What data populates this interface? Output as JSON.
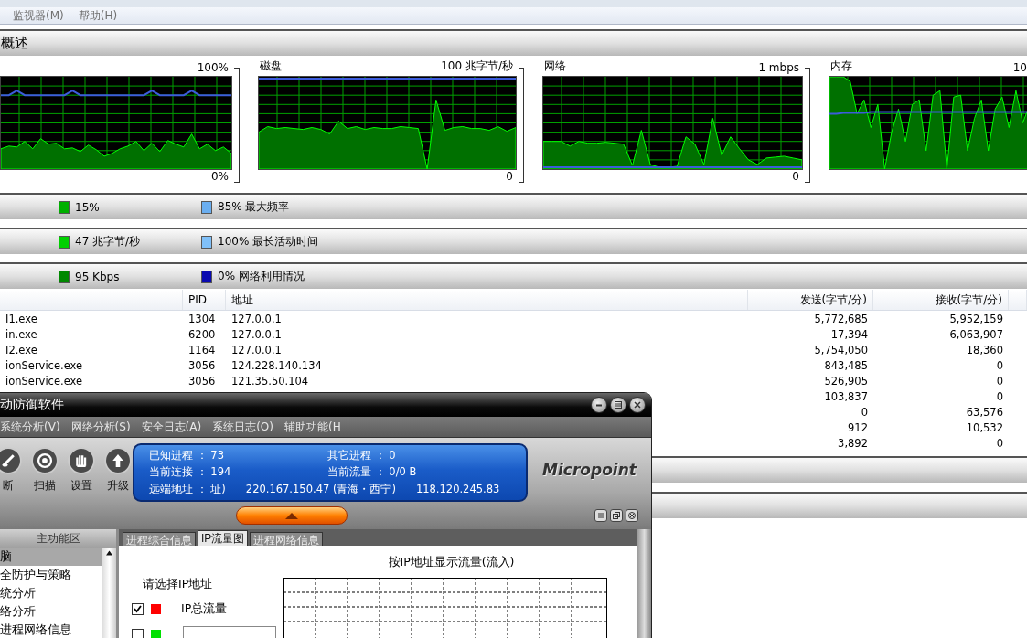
{
  "menu_bar": [
    {
      "label": "监视器(M)",
      "disabled": true
    },
    {
      "label": "帮助(H)",
      "disabled": true
    }
  ],
  "overview": {
    "title": "概述",
    "graphs": [
      {
        "scale_max": "100%",
        "scale_min": "0%"
      },
      {
        "title": "磁盘",
        "scale_max": "100 兆字节/秒",
        "scale_min": "0"
      },
      {
        "title": "网络",
        "scale_max": "1 mbps",
        "scale_min": "0"
      },
      {
        "title": "内存",
        "scale_max": "10"
      }
    ]
  },
  "summary_bars": [
    {
      "primary": {
        "text": "15%",
        "color": "#00b000"
      },
      "secondary": {
        "text": "85% 最大频率",
        "color": "#6aaef0"
      }
    },
    {
      "primary": {
        "text": "47 兆字节/秒",
        "color": "#00d000"
      },
      "secondary": {
        "text": "100% 最长活动时间",
        "color": "#80c0f8"
      }
    },
    {
      "primary": {
        "text": "95 Kbps",
        "color": "#008800"
      },
      "secondary": {
        "text": "0% 网络利用情况",
        "color": "#0a0ab0"
      }
    }
  ],
  "table": {
    "columns": [
      "PID",
      "地址",
      "发送(字节/分)",
      "接收(字节/分)"
    ],
    "rows": [
      {
        "column_1": "I1.exe",
        "pid": "1304",
        "address": "127.0.0.1",
        "sent": "5,772,685",
        "received": "5,952,159"
      },
      {
        "column_1": "in.exe",
        "pid": "6200",
        "address": "127.0.0.1",
        "sent": "17,394",
        "received": "6,063,907"
      },
      {
        "column_1": "I2.exe",
        "pid": "1164",
        "address": "127.0.0.1",
        "sent": "5,754,050",
        "received": "18,360"
      },
      {
        "column_1": "ionService.exe",
        "pid": "3056",
        "address": "124.228.140.134",
        "sent": "843,485",
        "received": "0"
      },
      {
        "column_1": "ionService.exe",
        "pid": "3056",
        "address": "121.35.50.104",
        "sent": "526,905",
        "received": "0"
      },
      {
        "sent": "103,837",
        "received": "0"
      },
      {
        "sent": "0",
        "received": "63,576"
      },
      {
        "sent": "912",
        "received": "10,532"
      },
      {
        "sent": "3,892",
        "received": "0"
      }
    ]
  },
  "overlay_window": {
    "title": "动防御软件",
    "menu": [
      "系统分析(V)",
      "网络分析(S)",
      "安全日志(A)",
      "系统日志(O)",
      "辅助功能(H"
    ],
    "toolbar": [
      {
        "label": "断",
        "kind": "cut"
      },
      {
        "label": "扫描",
        "kind": "scan"
      },
      {
        "label": "设置",
        "kind": "settings"
      },
      {
        "label": "升级",
        "kind": "upgrade"
      }
    ],
    "status": [
      [
        "已知进程 ： 73",
        "其它进程 ： 0"
      ],
      [
        "当前连接 ： 194",
        "当前流量 ： 0/0 B"
      ]
    ],
    "remote": [
      "远端地址 ：  址)",
      "220.167.150.47 (青海・西宁)",
      "118.120.245.83"
    ],
    "logo": "Micropoint",
    "side_panel": {
      "title": "主功能区",
      "items": [
        {
          "label": "脑",
          "selected": true
        },
        {
          "label": "全防护与策略",
          "selected": false
        },
        {
          "label": "统分析",
          "selected": false
        },
        {
          "label": "络分析",
          "selected": false
        },
        {
          "label": "进程网络信息",
          "selected": false
        }
      ]
    },
    "tabs": [
      {
        "label": "进程综合信息",
        "selected": false
      },
      {
        "label": "IP流量图",
        "selected": true
      },
      {
        "label": "进程网络信息",
        "selected": false
      }
    ],
    "prompt": "请选择IP地址",
    "ip_options": [
      {
        "label": "IP总流量",
        "checked": true,
        "color": "#ff0000"
      },
      {
        "checked": false,
        "color": "#00e000"
      }
    ],
    "chart_title": "按IP地址显示流量(流入)"
  }
}
